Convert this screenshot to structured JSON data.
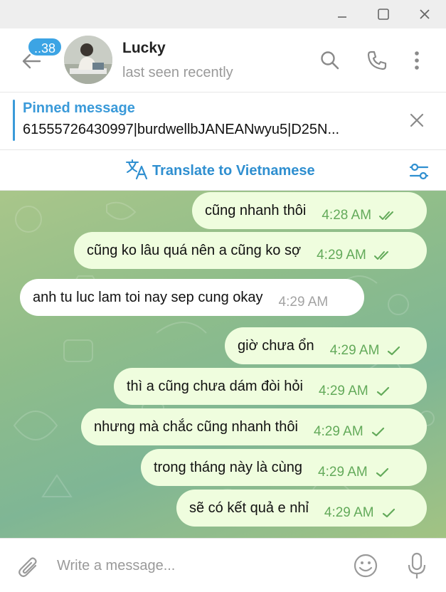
{
  "window": {
    "controls": [
      "minimize-icon",
      "maximize-icon",
      "close-icon"
    ]
  },
  "header": {
    "unread_badge": "..38",
    "name": "Lucky",
    "status": "last seen recently",
    "icons": [
      "back-arrow-icon",
      "search-icon",
      "phone-icon",
      "more-vertical-icon"
    ]
  },
  "pinned": {
    "title": "Pinned message",
    "text": "61555726430997|burdwellbJANEANwyu5|D25N..."
  },
  "translate": {
    "label": "Translate to Vietnamese",
    "icons": [
      "translate-icon",
      "translate-settings-icon"
    ]
  },
  "messages": [
    {
      "direction": "out",
      "text": "cũng nhanh thôi",
      "time": "4:28 AM",
      "status": "read"
    },
    {
      "direction": "out",
      "text": "cũng ko lâu quá nên a cũng ko sợ",
      "time": "4:29 AM",
      "status": "read"
    },
    {
      "direction": "in",
      "text": "anh tu luc lam toi nay sep cung okay",
      "time": "4:29 AM"
    },
    {
      "direction": "out",
      "text": "giờ chưa ổn",
      "time": "4:29 AM",
      "status": "sent"
    },
    {
      "direction": "out",
      "text": "thì a cũng chưa dám đòi hỏi",
      "time": "4:29 AM",
      "status": "sent"
    },
    {
      "direction": "out",
      "text": "nhưng mà chắc cũng nhanh thôi",
      "time": "4:29 AM",
      "status": "sent"
    },
    {
      "direction": "out",
      "text": "trong tháng này là cùng",
      "time": "4:29 AM",
      "status": "sent"
    },
    {
      "direction": "out",
      "text": "sẽ có kết quả e nhỉ",
      "time": "4:29 AM",
      "status": "sent"
    }
  ],
  "composer": {
    "placeholder": "Write a message...",
    "icons": [
      "paperclip-icon",
      "emoji-icon",
      "microphone-icon"
    ]
  },
  "colors": {
    "accent": "#3a9ad9",
    "badge": "#3ca4e4",
    "outgoing_bubble": "#effdde",
    "incoming_bubble": "#ffffff",
    "outgoing_time": "#63aa5a",
    "chat_background": "#8fbd8a"
  }
}
